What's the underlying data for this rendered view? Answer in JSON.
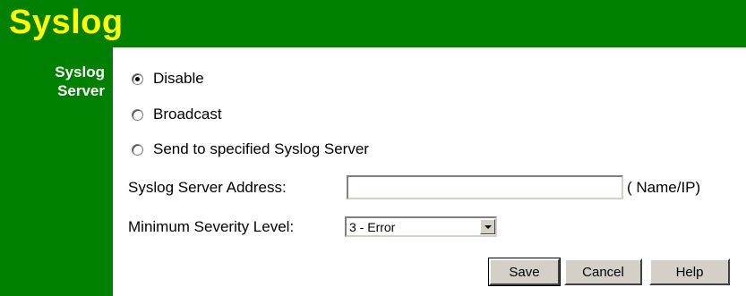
{
  "header": {
    "title": "Syslog"
  },
  "sidebar": {
    "label_line1": "Syslog",
    "label_line2": "Server"
  },
  "options": [
    {
      "label": "Disable",
      "checked": true
    },
    {
      "label": "Broadcast",
      "checked": false
    },
    {
      "label": "Send to specified Syslog Server",
      "checked": false
    }
  ],
  "server_address": {
    "label": "Syslog Server Address:",
    "value": "",
    "unit": "( Name/IP)"
  },
  "severity": {
    "label": "Minimum Severity Level:",
    "selected": "3 - Error"
  },
  "buttons": {
    "save": "Save",
    "cancel": "Cancel",
    "help": "Help"
  },
  "colors": {
    "header_bg": "#008000",
    "title": "#ffff00",
    "sidebar_text": "#ffffff"
  }
}
